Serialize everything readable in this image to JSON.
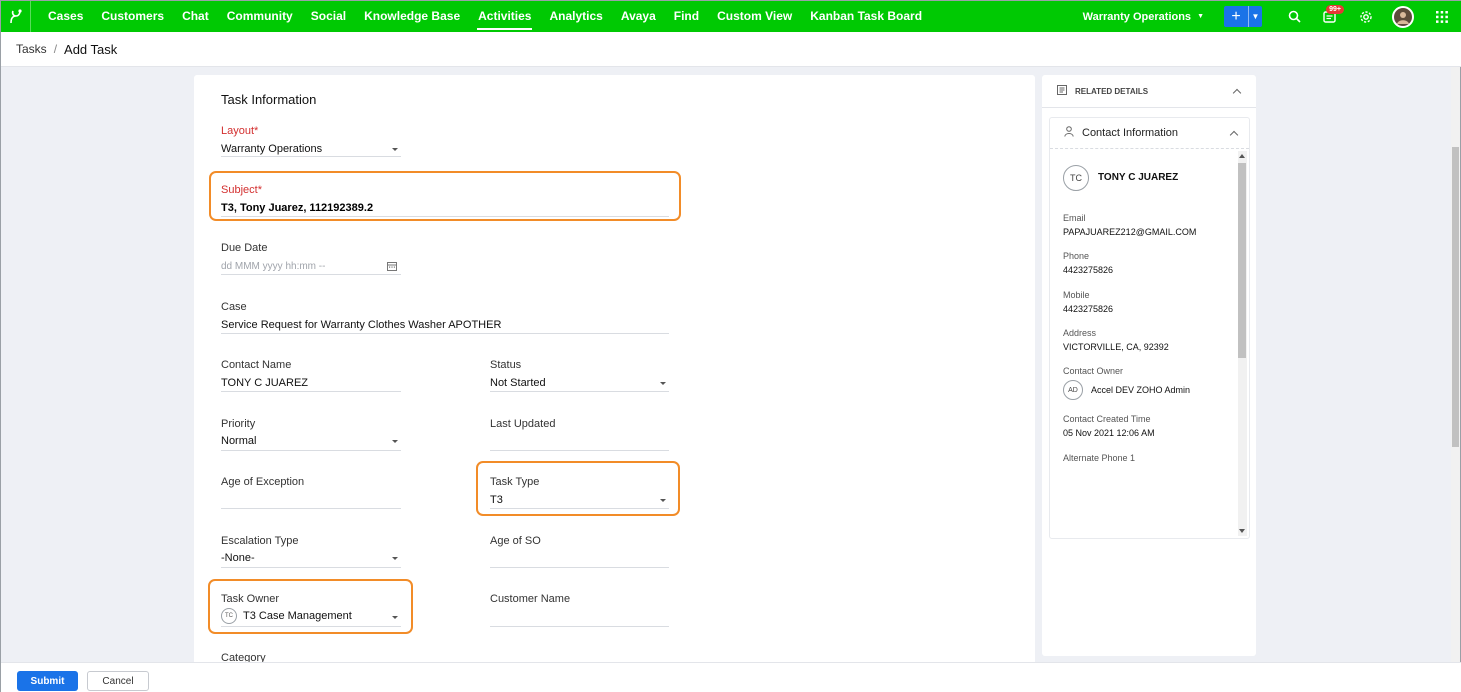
{
  "nav": {
    "items": [
      {
        "label": "Cases"
      },
      {
        "label": "Customers"
      },
      {
        "label": "Chat"
      },
      {
        "label": "Community"
      },
      {
        "label": "Social"
      },
      {
        "label": "Knowledge Base"
      },
      {
        "label": "Activities",
        "active": true
      },
      {
        "label": "Analytics"
      },
      {
        "label": "Avaya"
      },
      {
        "label": "Find"
      },
      {
        "label": "Custom View"
      },
      {
        "label": "Kanban Task Board"
      }
    ],
    "department": "Warranty Operations",
    "notification_badge": "99+",
    "brand_color": "#00c903",
    "accent_color": "#1a73e8",
    "icons": [
      "app-logo-icon",
      "plus-icon",
      "search-icon",
      "notification-icon",
      "settings-icon",
      "profile-avatar",
      "app-grid-icon"
    ]
  },
  "breadcrumb": {
    "parent": "Tasks",
    "separator": "/",
    "current": "Add Task"
  },
  "form": {
    "section_title": "Task Information",
    "layout": {
      "label": "Layout",
      "required_mark": "*",
      "value": "Warranty Operations"
    },
    "subject": {
      "label": "Subject",
      "required_mark": "*",
      "value": "T3, Tony Juarez, 112192389.2"
    },
    "due_date": {
      "label": "Due Date",
      "placeholder": "dd MMM yyyy hh:mm --"
    },
    "case": {
      "label": "Case",
      "value": "Service Request for Warranty Clothes Washer APOTHER"
    },
    "contact_name": {
      "label": "Contact Name",
      "value": "TONY C JUAREZ"
    },
    "status": {
      "label": "Status",
      "value": "Not Started"
    },
    "priority": {
      "label": "Priority",
      "value": "Normal"
    },
    "last_updated": {
      "label": "Last Updated",
      "value": ""
    },
    "age_of_exception": {
      "label": "Age of Exception",
      "value": ""
    },
    "task_type": {
      "label": "Task Type",
      "value": "T3"
    },
    "escalation_type": {
      "label": "Escalation Type",
      "value": "-None-"
    },
    "age_of_so": {
      "label": "Age of SO",
      "value": ""
    },
    "task_owner": {
      "label": "Task Owner",
      "avatar": "TC",
      "value": "T3 Case Management"
    },
    "customer_name": {
      "label": "Customer Name",
      "value": ""
    },
    "category": {
      "label": "Category"
    },
    "highlight_color": "#f28c28"
  },
  "related": {
    "title": "RELATED DETAILS",
    "contact_info": {
      "title": "Contact Information",
      "avatar": "TC",
      "name": "TONY C JUAREZ",
      "email_label": "Email",
      "email": "PAPAJUAREZ212@GMAIL.COM",
      "phone_label": "Phone",
      "phone": "4423275826",
      "mobile_label": "Mobile",
      "mobile": "4423275826",
      "address_label": "Address",
      "address": "VICTORVILLE, CA, 92392",
      "owner_label": "Contact Owner",
      "owner_avatar": "AD",
      "owner": "Accel DEV ZOHO Admin",
      "created_label": "Contact Created Time",
      "created": "05 Nov 2021 12:06 AM",
      "alt_phone_label": "Alternate Phone 1"
    }
  },
  "footer": {
    "submit": "Submit",
    "cancel": "Cancel"
  }
}
